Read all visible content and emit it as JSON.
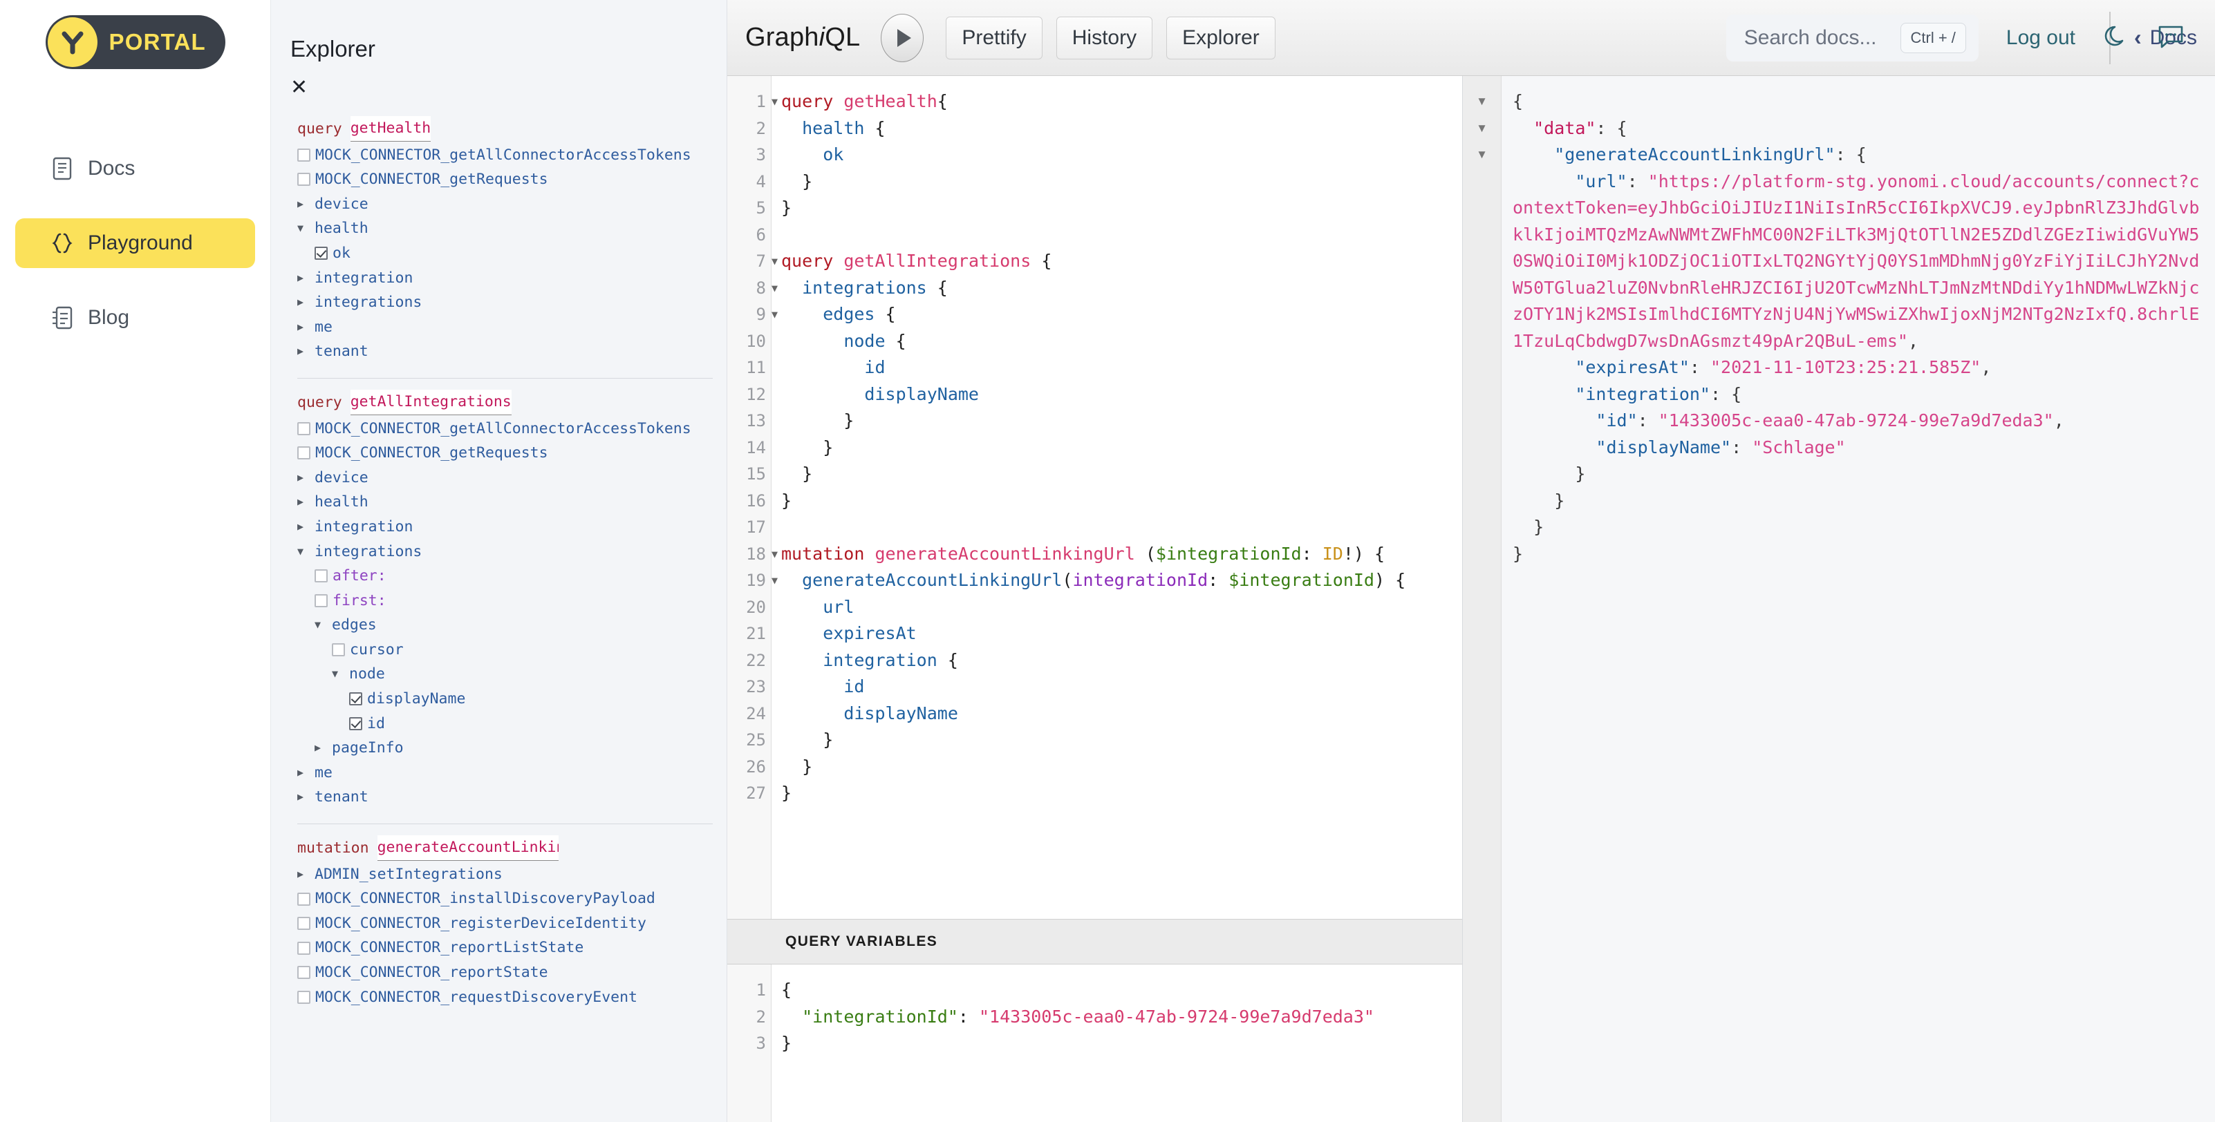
{
  "brand": {
    "word": "PORTAL",
    "logo_icon": "y-logo-icon",
    "accent": "#fbe15a",
    "dark": "#3a4049"
  },
  "sidebar": {
    "items": [
      {
        "label": "Docs",
        "icon": "document-icon",
        "active": false
      },
      {
        "label": "Playground",
        "icon": "braces-icon",
        "active": true
      },
      {
        "label": "Blog",
        "icon": "blog-icon",
        "active": false
      }
    ]
  },
  "header": {
    "search_placeholder": "Search docs...",
    "search_value": "",
    "shortcut": "Ctrl + /",
    "logout_label": "Log out",
    "theme_icon": "moon-icon",
    "feedback_icon": "chat-bubble-icon"
  },
  "explorer": {
    "title": "Explorer",
    "close_label": "✕",
    "operations": [
      {
        "keyword": "query",
        "name": "getHealth",
        "fields": [
          {
            "label": "MOCK_CONNECTOR_getAllConnectorAccessTokens",
            "kind": "checkbox",
            "checked": false,
            "indent": 1
          },
          {
            "label": "MOCK_CONNECTOR_getRequests",
            "kind": "checkbox",
            "checked": false,
            "indent": 1
          },
          {
            "label": "device",
            "kind": "arrow",
            "expanded": false,
            "indent": 1
          },
          {
            "label": "health",
            "kind": "arrow",
            "expanded": true,
            "indent": 1
          },
          {
            "label": "ok",
            "kind": "checkbox",
            "checked": true,
            "indent": 2
          },
          {
            "label": "integration",
            "kind": "arrow",
            "expanded": false,
            "indent": 1
          },
          {
            "label": "integrations",
            "kind": "arrow",
            "expanded": false,
            "indent": 1
          },
          {
            "label": "me",
            "kind": "arrow",
            "expanded": false,
            "indent": 1
          },
          {
            "label": "tenant",
            "kind": "arrow",
            "expanded": false,
            "indent": 1
          }
        ]
      },
      {
        "keyword": "query",
        "name": "getAllIntegrations",
        "fields": [
          {
            "label": "MOCK_CONNECTOR_getAllConnectorAccessTokens",
            "kind": "checkbox",
            "checked": false,
            "indent": 1
          },
          {
            "label": "MOCK_CONNECTOR_getRequests",
            "kind": "checkbox",
            "checked": false,
            "indent": 1
          },
          {
            "label": "device",
            "kind": "arrow",
            "expanded": false,
            "indent": 1
          },
          {
            "label": "health",
            "kind": "arrow",
            "expanded": false,
            "indent": 1
          },
          {
            "label": "integration",
            "kind": "arrow",
            "expanded": false,
            "indent": 1
          },
          {
            "label": "integrations",
            "kind": "arrow",
            "expanded": true,
            "indent": 1
          },
          {
            "label": "after:",
            "kind": "checkbox",
            "checked": false,
            "indent": 2,
            "arg": true
          },
          {
            "label": "first:",
            "kind": "checkbox",
            "checked": false,
            "indent": 2,
            "arg": true
          },
          {
            "label": "edges",
            "kind": "arrow",
            "expanded": true,
            "indent": 2
          },
          {
            "label": "cursor",
            "kind": "checkbox",
            "checked": false,
            "indent": 3
          },
          {
            "label": "node",
            "kind": "arrow",
            "expanded": true,
            "indent": 3
          },
          {
            "label": "displayName",
            "kind": "checkbox",
            "checked": true,
            "indent": 4
          },
          {
            "label": "id",
            "kind": "checkbox",
            "checked": true,
            "indent": 4
          },
          {
            "label": "pageInfo",
            "kind": "arrow",
            "expanded": false,
            "indent": 2
          },
          {
            "label": "me",
            "kind": "arrow",
            "expanded": false,
            "indent": 1
          },
          {
            "label": "tenant",
            "kind": "arrow",
            "expanded": false,
            "indent": 1
          }
        ]
      },
      {
        "keyword": "mutation",
        "name": "generateAccountLinkingUrl",
        "fields": [
          {
            "label": "ADMIN_setIntegrations",
            "kind": "arrow",
            "expanded": false,
            "indent": 1
          },
          {
            "label": "MOCK_CONNECTOR_installDiscoveryPayload",
            "kind": "checkbox",
            "checked": false,
            "indent": 1
          },
          {
            "label": "MOCK_CONNECTOR_registerDeviceIdentity",
            "kind": "checkbox",
            "checked": false,
            "indent": 1
          },
          {
            "label": "MOCK_CONNECTOR_reportListState",
            "kind": "checkbox",
            "checked": false,
            "indent": 1
          },
          {
            "label": "MOCK_CONNECTOR_reportState",
            "kind": "checkbox",
            "checked": false,
            "indent": 1
          },
          {
            "label": "MOCK_CONNECTOR_requestDiscoveryEvent",
            "kind": "checkbox",
            "checked": false,
            "indent": 1
          }
        ]
      }
    ]
  },
  "graphiql": {
    "logo_pre": "Graph",
    "logo_it": "i",
    "logo_post": "QL",
    "execute_icon": "play-icon",
    "buttons": [
      {
        "label": "Prettify"
      },
      {
        "label": "History"
      },
      {
        "label": "Explorer"
      }
    ],
    "docs_label": "Docs",
    "docs_chevron_icon": "chevron-left-icon"
  },
  "query_editor": {
    "lines": [
      {
        "n": 1,
        "fold": true,
        "text": "query getHealth{"
      },
      {
        "n": 2,
        "fold": false,
        "text": "  health {"
      },
      {
        "n": 3,
        "fold": false,
        "text": "    ok"
      },
      {
        "n": 4,
        "fold": false,
        "text": "  }"
      },
      {
        "n": 5,
        "fold": false,
        "text": "}"
      },
      {
        "n": 6,
        "fold": false,
        "text": ""
      },
      {
        "n": 7,
        "fold": true,
        "text": "query getAllIntegrations {"
      },
      {
        "n": 8,
        "fold": true,
        "text": "  integrations {"
      },
      {
        "n": 9,
        "fold": true,
        "text": "    edges {"
      },
      {
        "n": 10,
        "fold": false,
        "text": "      node {"
      },
      {
        "n": 11,
        "fold": false,
        "text": "        id"
      },
      {
        "n": 12,
        "fold": false,
        "text": "        displayName"
      },
      {
        "n": 13,
        "fold": false,
        "text": "      }"
      },
      {
        "n": 14,
        "fold": false,
        "text": "    }"
      },
      {
        "n": 15,
        "fold": false,
        "text": "  }"
      },
      {
        "n": 16,
        "fold": false,
        "text": "}"
      },
      {
        "n": 17,
        "fold": false,
        "text": ""
      },
      {
        "n": 18,
        "fold": true,
        "text": "mutation generateAccountLinkingUrl ($integrationId: ID!) {"
      },
      {
        "n": 19,
        "fold": true,
        "text": "  generateAccountLinkingUrl(integrationId: $integrationId) {"
      },
      {
        "n": 20,
        "fold": false,
        "text": "    url"
      },
      {
        "n": 21,
        "fold": false,
        "text": "    expiresAt"
      },
      {
        "n": 22,
        "fold": false,
        "text": "    integration {"
      },
      {
        "n": 23,
        "fold": false,
        "text": "      id"
      },
      {
        "n": 24,
        "fold": false,
        "text": "      displayName"
      },
      {
        "n": 25,
        "fold": false,
        "text": "    }"
      },
      {
        "n": 26,
        "fold": false,
        "text": "  }"
      },
      {
        "n": 27,
        "fold": false,
        "text": "}"
      }
    ]
  },
  "query_variables": {
    "header": "QUERY VARIABLES",
    "lines": [
      {
        "n": 1,
        "text": "{"
      },
      {
        "n": 2,
        "text": "  \"integrationId\": \"1433005c-eaa0-47ab-9724-99e7a9d7eda3\""
      },
      {
        "n": 3,
        "text": "}"
      }
    ],
    "key": "integrationId",
    "value": "1433005c-eaa0-47ab-9724-99e7a9d7eda3"
  },
  "response": {
    "data_key": "data",
    "operation_key": "generateAccountLinkingUrl",
    "url_key": "url",
    "url_value": "https://platform-stg.yonomi.cloud/accounts/connect?contextToken=eyJhbGciOiJIUzI1NiIsInR5cCI6IkpXVCJ9.eyJpbnRlZ3JhdGlvbklkIjoiMTQzMzAwNWMtZWFhMC00N2FiLTk3MjQtOTllN2E5ZDdlZGEzIiwidGVuYW50SWQiOiI0Mjk1ODZjOC1iOTIxLTQ2NGYtYjQ0YS1mMDhmNjg0YzFiYjIiLCJhY2NvdW50TGlua2luZ0NvbnRleHRJZCI6IjU2OTcwMzNhLTJmNzMtNDdiYy1hNDMwLWZkNjczOTY1Njk2MSIsImlhdCI6MTYzNjU4NjYwMSwiZXhwIjoxNjM2NTg2NzIxfQ.8chrlE1TzuLqCbdwgD7wsDnAGsmzt49pAr2QBuL-ems",
    "expires_key": "expiresAt",
    "expires_value": "2021-11-10T23:25:21.585Z",
    "integration_key": "integration",
    "id_key": "id",
    "id_value": "1433005c-eaa0-47ab-9724-99e7a9d7eda3",
    "display_key": "displayName",
    "display_value": "Schlage"
  }
}
